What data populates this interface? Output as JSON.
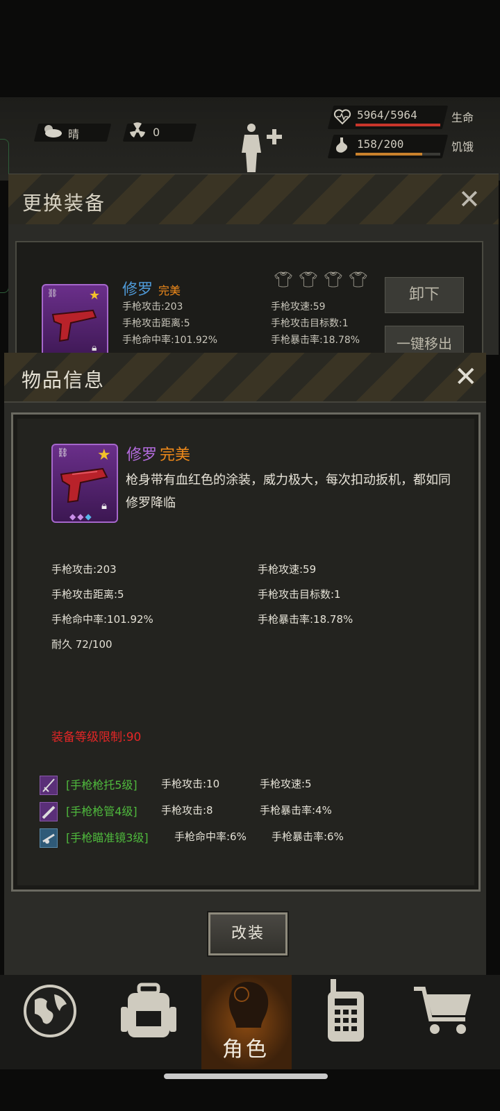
{
  "hud": {
    "weather": "晴",
    "radiation": "0",
    "health_value": "5964/5964",
    "health_label": "生命",
    "health_fraction": 1.0,
    "hunger_value": "158/200",
    "hunger_label": "饥饿",
    "hunger_fraction": 0.79
  },
  "equip_panel": {
    "title": "更换装备",
    "item_name": "修罗",
    "item_grade": "完美",
    "stats": [
      "手枪攻击:203",
      "手枪攻速:59",
      "手枪攻击距离:5",
      "手枪攻击目标数:1",
      "手枪命中率:101.92%",
      "手枪暴击率:18.78%"
    ],
    "unequip_label": "卸下",
    "remove_all_label": "一键移出"
  },
  "dialog": {
    "title": "物品信息",
    "item_name": "修罗",
    "item_grade": "完美",
    "description": "枪身带有血红色的涂装，威力极大，每次扣动扳机，都如同修罗降临",
    "stats_left": [
      "手枪攻击:203",
      "手枪攻击距离:5",
      "手枪命中率:101.92%",
      "耐久 72/100"
    ],
    "stats_right": [
      "手枪攻速:59",
      "手枪攻击目标数:1",
      "手枪暴击率:18.78%"
    ],
    "level_limit": "装备等级限制:90",
    "mods": [
      {
        "name": "[手枪枪托5级]",
        "stat1": "手枪攻击:10",
        "stat2": "手枪攻速:5",
        "icon": "stock-icon",
        "color": "#5a2f78"
      },
      {
        "name": "[手枪枪管4级]",
        "stat1": "手枪攻击:8",
        "stat2": "手枪暴击率:4%",
        "icon": "barrel-icon",
        "color": "#5a2f78"
      },
      {
        "name": "[手枪瞄准镜3级]",
        "stat1": "手枪命中率:6%",
        "stat2": "手枪暴击率:6%",
        "icon": "scope-icon",
        "color": "#2f5a78"
      }
    ],
    "modify_label": "改装"
  },
  "nav": {
    "items": [
      {
        "icon": "globe-icon"
      },
      {
        "icon": "backpack-icon"
      },
      {
        "icon": "character-icon",
        "label": "角色",
        "active": true
      },
      {
        "icon": "radio-icon"
      },
      {
        "icon": "cart-icon"
      }
    ]
  },
  "colors": {
    "grade_orange": "#f08a1a",
    "purple_name": "#b56ce0",
    "mod_green": "#4fba3d",
    "warning_red": "#e42626",
    "health_red": "#c8352b",
    "hunger_orange": "#c9812c"
  }
}
